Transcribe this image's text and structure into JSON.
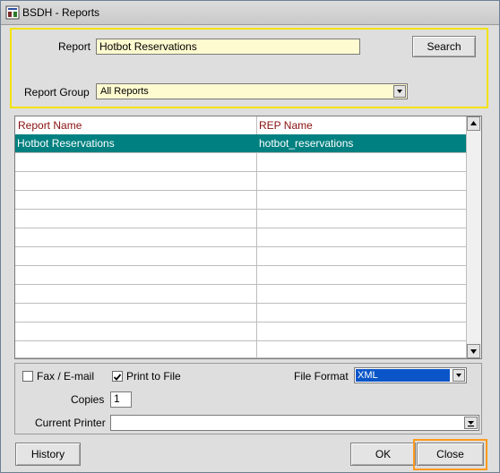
{
  "window": {
    "title": "BSDH - Reports"
  },
  "search": {
    "report_label": "Report",
    "report_value": "Hotbot Reservations",
    "search_button": "Search",
    "group_label": "Report Group",
    "group_value": "All Reports"
  },
  "grid": {
    "columns": [
      "Report Name",
      "REP Name"
    ],
    "rows": [
      {
        "report_name": "Hotbot Reservations",
        "rep_name": "hotbot_reservations",
        "selected": true
      }
    ],
    "empty_rows": 11
  },
  "options": {
    "fax_label": "Fax / E-mail",
    "fax_checked": false,
    "print_label": "Print to File",
    "print_checked": true,
    "format_label": "File Format",
    "format_value": "XML",
    "copies_label": "Copies",
    "copies_value": "1",
    "printer_label": "Current Printer",
    "printer_value": ""
  },
  "footer": {
    "history_button": "History",
    "ok_button": "OK",
    "close_button": "Close"
  },
  "colors": {
    "selection": "#008080",
    "header_text": "#8a1010",
    "field_bg": "#fffbd0",
    "focus_highlight": "#f2e200",
    "close_focus": "#ff9a1e"
  }
}
